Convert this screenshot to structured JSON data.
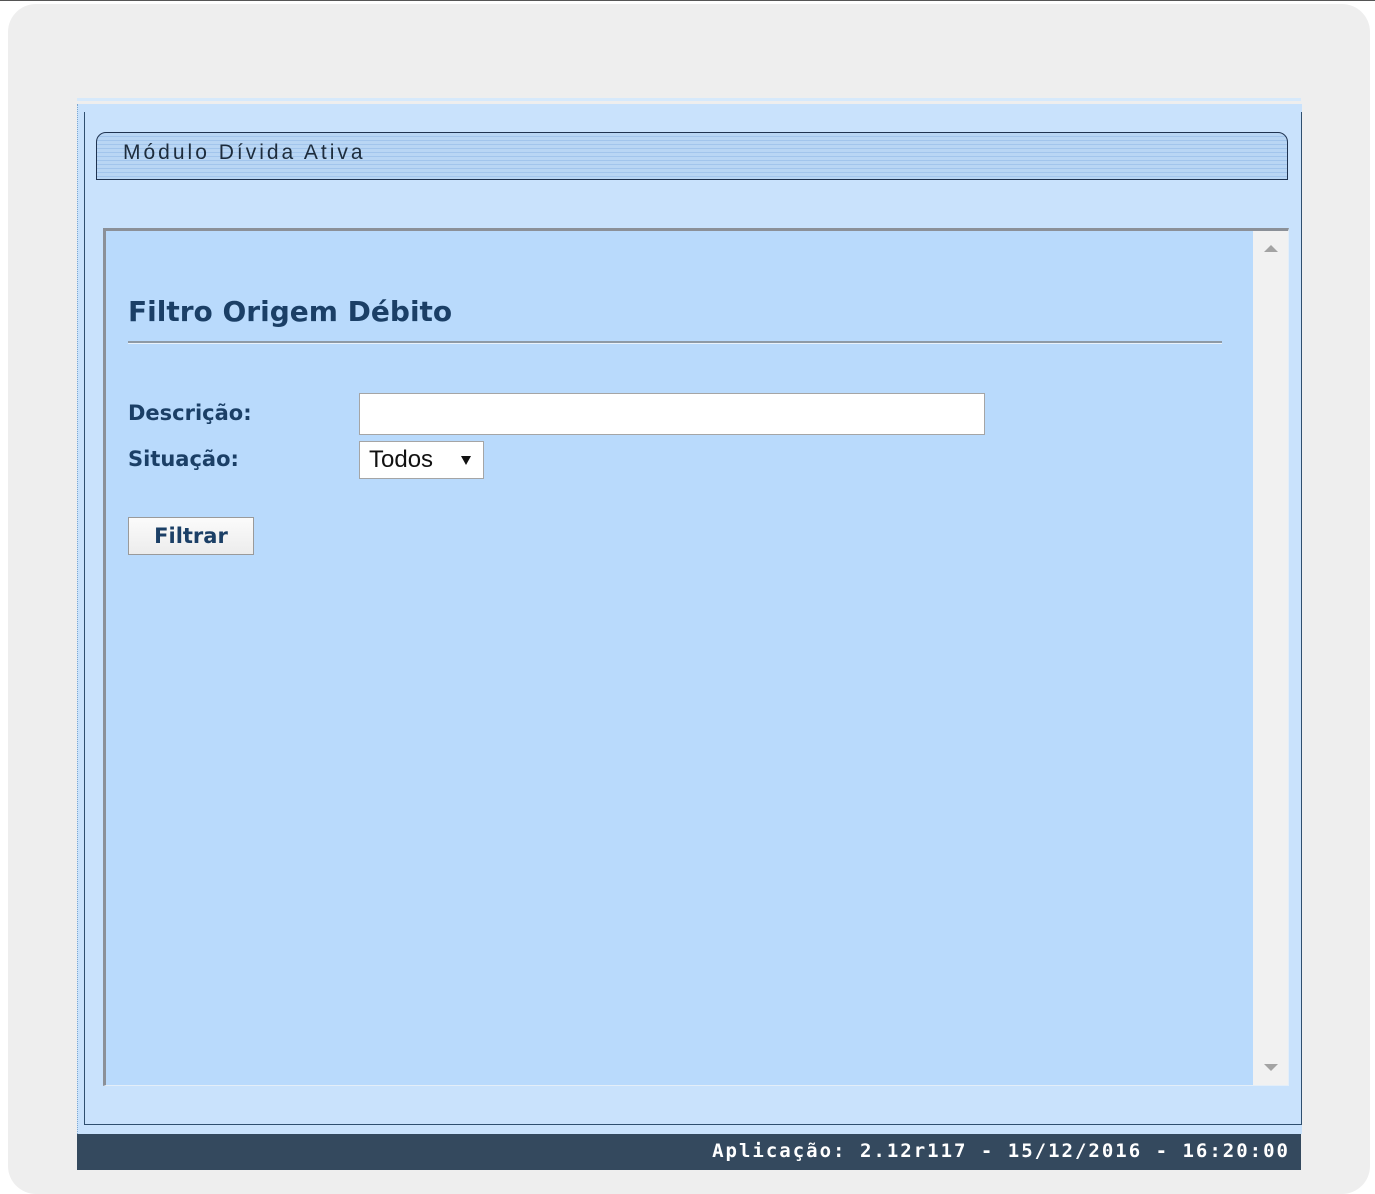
{
  "module": {
    "title": "Módulo Dívida Ativa"
  },
  "page": {
    "title": "Filtro Origem Débito"
  },
  "form": {
    "descricao_label": "Descrição:",
    "descricao_value": "",
    "situacao_label": "Situação:",
    "situacao_selected": "Todos",
    "filter_button_label": "Filtrar"
  },
  "footer": {
    "app_info": "Aplicação: 2.12r117 - 15/12/2016 - 16:20:00"
  },
  "colors": {
    "panel_background": "#b9dafc",
    "heading_text": "#1b3f66",
    "footer_background": "#34495e"
  },
  "icons": {
    "scroll_up": "triangle-up",
    "scroll_down": "triangle-down",
    "select_dropdown": "triangle-down"
  }
}
